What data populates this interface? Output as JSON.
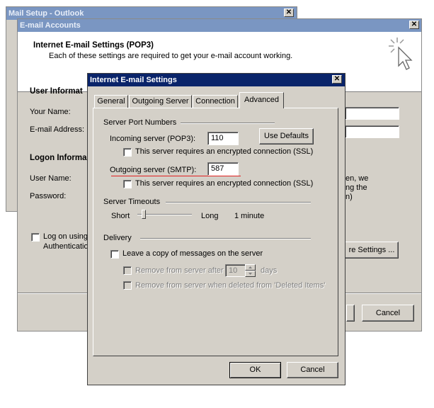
{
  "mail_setup": {
    "title": "Mail Setup - Outlook"
  },
  "email_accounts": {
    "title": "E-mail Accounts",
    "heading": "Internet E-mail Settings (POP3)",
    "subheading": "Each of these settings are required to get your e-mail account working.",
    "user_info": "User Informat",
    "your_name": "Your Name:",
    "email_address": "E-mail Address:",
    "logon_info": "Logon Informa",
    "user_name": "User Name:",
    "password": "Password:",
    "log_on_using": "Log on using",
    "authentication": "Authenticatio",
    "right_text_1": "en, we",
    "right_text_2": "ng the",
    "right_text_3": "n)",
    "more_settings": "re Settings ...",
    "cancel": "Cancel"
  },
  "settings": {
    "title": "Internet E-mail Settings",
    "tabs": [
      "General",
      "Outgoing Server",
      "Connection",
      "Advanced"
    ],
    "server_port_numbers": "Server Port Numbers",
    "incoming_label": "Incoming server (POP3):",
    "incoming_value": "110",
    "use_defaults": "Use Defaults",
    "ssl_incoming": "This server requires an encrypted connection (SSL)",
    "outgoing_label": "Outgoing server (SMTP):",
    "outgoing_value": "587",
    "ssl_outgoing": "This server requires an encrypted connection (SSL)",
    "server_timeouts": "Server Timeouts",
    "short": "Short",
    "long": "Long",
    "timeout_value": "1 minute",
    "timeout_fraction": 0.08,
    "delivery": "Delivery",
    "leave_copy": "Leave a copy of messages on the server",
    "remove_after": "Remove from server after",
    "days_value": "10",
    "days": "days",
    "remove_deleted": "Remove from server when deleted from 'Deleted Items'",
    "ok": "OK",
    "cancel": "Cancel"
  },
  "colors": {
    "underline": "#e02020",
    "active_title": "#0a246a"
  }
}
